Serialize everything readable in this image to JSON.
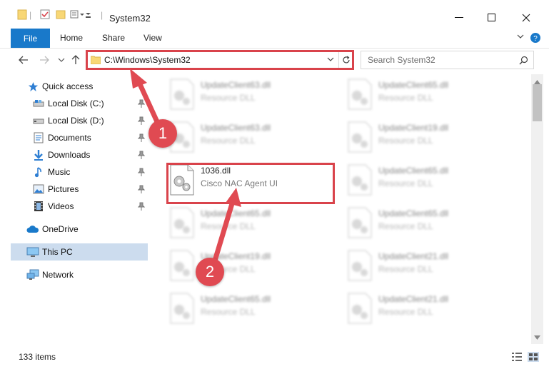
{
  "window": {
    "title": "System32"
  },
  "ribbon": {
    "file": "File",
    "home": "Home",
    "share": "Share",
    "view": "View"
  },
  "address": {
    "path": "C:\\Windows\\System32"
  },
  "search": {
    "placeholder": "Search System32"
  },
  "sidebar": {
    "items": [
      {
        "label": "Quick access",
        "icon": "star-icon"
      },
      {
        "label": "Local Disk (C:)",
        "icon": "drive-icon",
        "pinned": true
      },
      {
        "label": "Local Disk (D:)",
        "icon": "drive-icon",
        "pinned": true
      },
      {
        "label": "Documents",
        "icon": "documents-icon",
        "pinned": true
      },
      {
        "label": "Downloads",
        "icon": "downloads-icon",
        "pinned": true
      },
      {
        "label": "Music",
        "icon": "music-icon",
        "pinned": true
      },
      {
        "label": "Pictures",
        "icon": "pictures-icon",
        "pinned": true
      },
      {
        "label": "Videos",
        "icon": "videos-icon",
        "pinned": true
      },
      {
        "label": "OneDrive",
        "icon": "cloud-icon"
      },
      {
        "label": "This PC",
        "icon": "pc-icon",
        "selected": true
      },
      {
        "label": "Network",
        "icon": "network-icon"
      }
    ]
  },
  "files": {
    "left": [
      {
        "name": "UpdateClient63.dll",
        "type": "Resource DLL"
      },
      {
        "name": "UpdateClient63.dll",
        "type": "Resource DLL"
      },
      {
        "name": "1036.dll",
        "type": "Cisco NAC Agent UI"
      },
      {
        "name": "UpdateClient65.dll",
        "type": "Resource DLL"
      },
      {
        "name": "UpdateClient19.dll",
        "type": "Resource DLL"
      },
      {
        "name": "UpdateClient65.dll",
        "type": "Resource DLL"
      }
    ],
    "right": [
      {
        "name": "UpdateClient65.dll",
        "type": "Resource DLL"
      },
      {
        "name": "UpdateClient19.dll",
        "type": "Resource DLL"
      },
      {
        "name": "UpdateClient65.dll",
        "type": "Resource DLL"
      },
      {
        "name": "UpdateClient65.dll",
        "type": "Resource DLL"
      },
      {
        "name": "UpdateClient21.dll",
        "type": "Resource DLL"
      },
      {
        "name": "UpdateClient21.dll",
        "type": "Resource DLL"
      }
    ]
  },
  "status": {
    "count": "133 items"
  },
  "annotations": {
    "step1": "1",
    "step2": "2"
  },
  "colors": {
    "accent": "#1979ca",
    "annotation_red": "#d9434b",
    "selected": "#ccdcee"
  }
}
